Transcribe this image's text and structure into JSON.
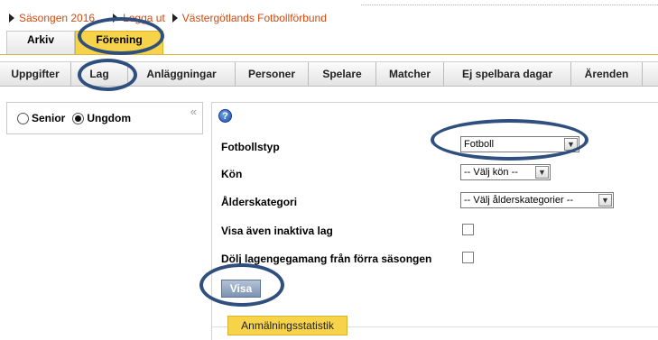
{
  "top_links": [
    {
      "label": "Säsongen 2016"
    },
    {
      "label": "Logga ut"
    },
    {
      "label": "Västergötlands Fotbollförbund"
    }
  ],
  "main_tabs": [
    {
      "label": "Arkiv"
    },
    {
      "label": "Förening"
    }
  ],
  "sub_nav": [
    {
      "label": "Uppgifter"
    },
    {
      "label": "Lag"
    },
    {
      "label": "Anläggningar"
    },
    {
      "label": "Personer"
    },
    {
      "label": "Spelare"
    },
    {
      "label": "Matcher"
    },
    {
      "label": "Ej spelbara dagar"
    },
    {
      "label": "Ärenden"
    }
  ],
  "left_panel": {
    "options": [
      {
        "label": "Senior",
        "selected": false
      },
      {
        "label": "Ungdom",
        "selected": true
      }
    ],
    "collapse_glyph": "«"
  },
  "form": {
    "help_glyph": "?",
    "fields": [
      {
        "label": "Fotbollstyp",
        "value": "Fotboll"
      },
      {
        "label": "Kön",
        "value": "-- Välj kön --"
      },
      {
        "label": "Ålderskategori",
        "value": "-- Välj ålderskategorier --"
      }
    ],
    "checkboxes": [
      {
        "label": "Visa även inaktiva lag",
        "checked": false
      },
      {
        "label": "Dölj lagengegamang från förra säsongen",
        "checked": false
      }
    ],
    "submit_label": "Visa"
  },
  "stats_tab": {
    "label": "Anmälningsstatistik"
  },
  "colors": {
    "link": "#d04a10",
    "active_tab": "#f7d34a",
    "annotation": "#2f4f7f",
    "button": "#7d93b3"
  }
}
